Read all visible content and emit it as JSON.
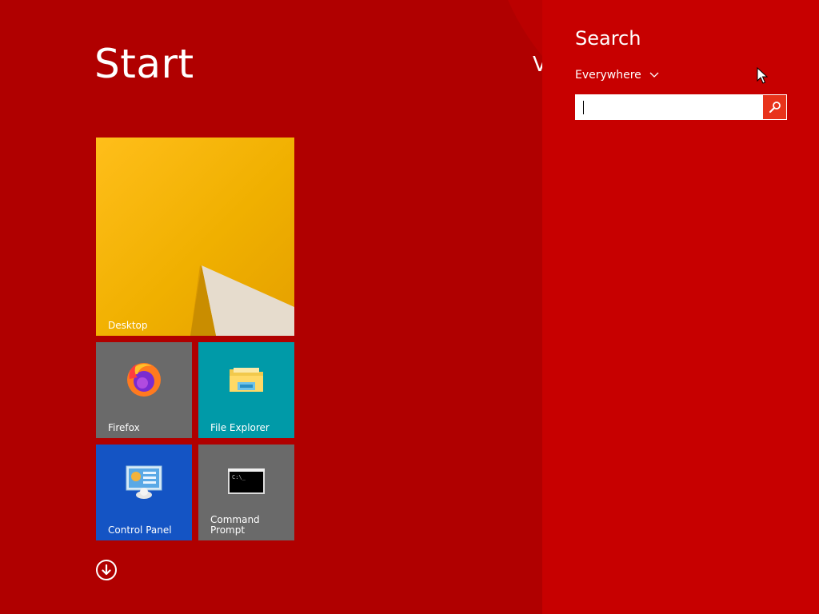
{
  "start": {
    "title": "Start",
    "user_peek": "V",
    "tiles": [
      {
        "label": "Desktop",
        "icon": "desktop-wallpaper"
      },
      {
        "label": "Firefox",
        "icon": "firefox-icon"
      },
      {
        "label": "File Explorer",
        "icon": "folder-icon"
      },
      {
        "label": "Control Panel",
        "icon": "control-panel-icon"
      },
      {
        "label": "Command Prompt",
        "icon": "terminal-icon"
      }
    ],
    "all_apps_icon": "arrow-down-circle-icon"
  },
  "search_charm": {
    "title": "Search",
    "scope": "Everywhere",
    "scope_icon": "chevron-down-icon",
    "input_value": "",
    "search_icon": "magnifier-icon"
  },
  "colors": {
    "background": "#b00000",
    "charm_background": "#c70000",
    "desktop_tile": "#f0b000",
    "firefox_tile": "#6a6a6a",
    "explorer_tile": "#009aa8",
    "control_panel_tile": "#1454c4",
    "command_prompt_tile": "#6a6a6a",
    "search_button": "#e8331b"
  }
}
